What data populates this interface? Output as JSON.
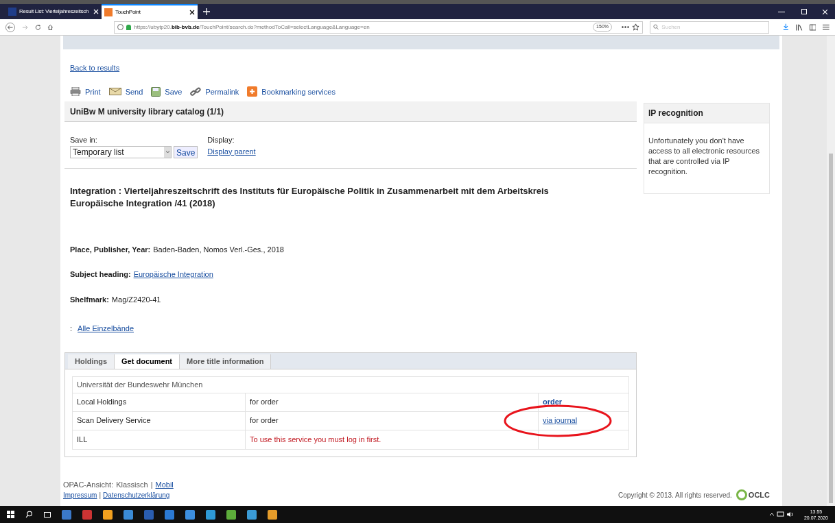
{
  "browser": {
    "tabs": [
      {
        "label": "Result List: Vierteljahreszeitsch",
        "selected": false
      },
      {
        "label": "TouchPoint",
        "selected": true
      }
    ],
    "url_prefix": "https://ubytp20.",
    "url_domain": "bib-bvb.de",
    "url_path": "/TouchPoint/search.do?methodToCall=selectLanguage&Language=en",
    "zoom": "150%",
    "search": {
      "placeholder": "Suchen"
    }
  },
  "page": {
    "back_link": "Back to results",
    "actions": [
      {
        "kind": "print",
        "label": "Print"
      },
      {
        "kind": "send",
        "label": "Send"
      },
      {
        "kind": "save",
        "label": "Save"
      },
      {
        "kind": "link",
        "label": "Permalink"
      },
      {
        "kind": "bookmark",
        "label": "Bookmarking services"
      }
    ],
    "catalog_title": "UniBw M university library catalog (1/1)",
    "save_in": {
      "label": "Save in:",
      "value": "Temporary list",
      "button": "Save"
    },
    "display": {
      "label": "Display:",
      "link": "Display parent"
    },
    "record_title": "Integration : Vierteljahreszeitschrift des Instituts für Europäische Politik in Zusammenarbeit mit dem Arbeitskreis Europäische Integration /41 (2018)",
    "fields": [
      {
        "label": "Place, Publisher, Year:",
        "value": "Baden-Baden, Nomos Verl.-Ges., 2018",
        "kind": "text"
      },
      {
        "label": "Subject heading:",
        "value": "Europäische Integration",
        "kind": "link"
      },
      {
        "label": "Shelfmark:",
        "value": "Mag/Z2420-41",
        "kind": "text"
      }
    ],
    "volumes": {
      "prefix": ":",
      "link": "Alle Einzelbände"
    },
    "tabs": [
      {
        "label": "Holdings",
        "selected": false
      },
      {
        "label": "Get document",
        "selected": true
      },
      {
        "label": "More title information",
        "selected": false
      }
    ],
    "library": "Universität der Bundeswehr München",
    "rows": [
      {
        "service": "Local Holdings",
        "status": "for order",
        "status_error": false,
        "action": "order",
        "action_bold": true,
        "circled": false
      },
      {
        "service": "Scan Delivery Service",
        "status": "for order",
        "status_error": false,
        "action": "via journal",
        "action_bold": false,
        "circled": true
      },
      {
        "service": "ILL",
        "status": "To use this service you must log in first.",
        "status_error": true,
        "circled": false
      }
    ],
    "footer": {
      "view_label": "OPAC-Ansicht:",
      "view_current": "Klassisch",
      "separator": "|",
      "view_link": "Mobil",
      "links": [
        "Impressum",
        "Datenschutzerklärung"
      ],
      "links_separator": "|",
      "copyright": "Copyright © 2013. All rights reserved.",
      "logo": "OCLC"
    },
    "sidebar": {
      "title": "IP recognition",
      "text": "Unfortunately you don't have access to all electronic resources that are controlled via IP recognition."
    }
  },
  "taskbar": {
    "time": "13:55",
    "date": "20.07.2020"
  }
}
